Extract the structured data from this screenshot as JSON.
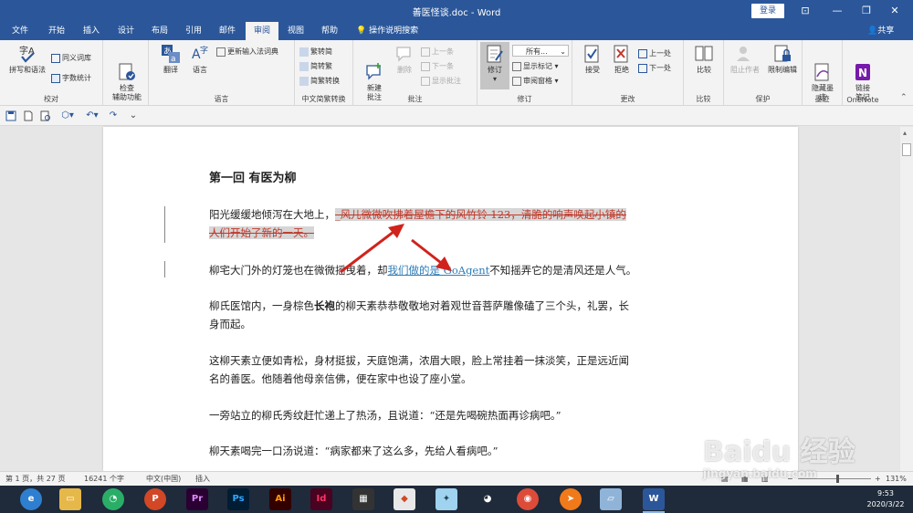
{
  "window": {
    "title": "善医怪谈.doc - Word",
    "login_label": "登录",
    "controls": [
      "⊡",
      "—",
      "❐",
      "✕"
    ]
  },
  "tabs": [
    "文件",
    "开始",
    "插入",
    "设计",
    "布局",
    "引用",
    "邮件",
    "审阅",
    "视图",
    "帮助"
  ],
  "active_tab": "审阅",
  "tell_me": "操作说明搜索",
  "share": "共享",
  "ribbon": {
    "proofing": {
      "label": "校对",
      "spelling": "拼写和语法",
      "thesaurus": "同义词库",
      "wordcount": "字数统计"
    },
    "accessibility": {
      "label": "辅助功能",
      "check": "检查\n辅助功能"
    },
    "language": {
      "label": "语言",
      "translate": "翻译",
      "language": "语言",
      "update_ime": "更新输入法词典"
    },
    "chinese": {
      "label": "中文简繁转换",
      "to_simp": "繁转简",
      "to_trad": "简转繁",
      "convert": "简繁转换"
    },
    "comments": {
      "label": "批注",
      "new": "新建\n批注",
      "delete": "删除",
      "prev": "上一条",
      "next": "下一条",
      "show": "显示批注"
    },
    "tracking": {
      "label": "修订",
      "track": "修订",
      "markup_select": "所有...",
      "show_markup": "显示标记",
      "review_pane": "审阅窗格"
    },
    "changes": {
      "label": "更改",
      "accept": "接受",
      "reject": "拒绝",
      "prev": "上一处",
      "next": "下一处"
    },
    "compare": {
      "label": "比较",
      "compare": "比较"
    },
    "protect": {
      "label": "保护",
      "block_authors": "阻止作者",
      "restrict": "限制编辑"
    },
    "ink": {
      "label": "墨迹",
      "hide_ink": "隐藏墨\n迹"
    },
    "onenote": {
      "label": "OneNote",
      "linked_notes": "链接\n笔记"
    }
  },
  "document": {
    "heading": "第一回  有医为柳",
    "p1_normal": "阳光缓缓地倾泻在大地上，",
    "p1_deleted_a": "_风儿微微吹拂着屋檐下的风竹铃 123，清脆的响声唤起小镇的",
    "p1_deleted_b": "人们开始了新的一天。",
    "p2_before": "柳宅大门外的灯笼也在微微摇曳着，却",
    "p2_inserted": "我们做的是 GoAgent",
    "p2_after": "不知摇弄它的是清风还是人气。",
    "p3_a": "柳氏医馆内，一身棕色",
    "p3_bold": "长袍",
    "p3_b": "的柳天素恭恭敬敬地对着观世音菩萨雕像磕了三个头，礼罢，长",
    "p3_c": "身而起。",
    "p4_a": "这柳天素立便如青松，身材挺拔，天庭饱满，浓眉大眼，脸上常挂着一抹淡笑，正是远近闻",
    "p4_b": "名的善医。他随着他母亲信佛，便在家中也设了座小堂。",
    "p5": "一旁站立的柳氏秀纹赶忙递上了热汤，且说道：“还是先喝碗热面再诊病吧。”",
    "p6": "柳天素喝完一口汤说道：“病家都来了这么多，先给人看病吧。”"
  },
  "statusbar": {
    "page": "第 1 页，共 27 页",
    "words": "16241 个字",
    "lang": "中文(中国)",
    "mode": "插入",
    "zoom": "131%"
  },
  "taskbar": {
    "apps": [
      "browser-360",
      "file-explorer",
      "wechat",
      "powerpoint",
      "premiere",
      "photoshop",
      "illustrator",
      "indesign",
      "video-editor",
      "ppt-tool",
      "bird-app",
      "qq",
      "chrome",
      "orange-app",
      "notes",
      "word"
    ],
    "time": "9:53",
    "date": "2020/3/22"
  },
  "watermark": {
    "brand": "Baidu 经验",
    "url": "jingyan.baidu.com"
  },
  "colors": {
    "word_blue": "#2b579a",
    "deleted_text": "#c0392b",
    "inserted_text": "#2e7db8",
    "arrow_red": "#d0231c"
  }
}
